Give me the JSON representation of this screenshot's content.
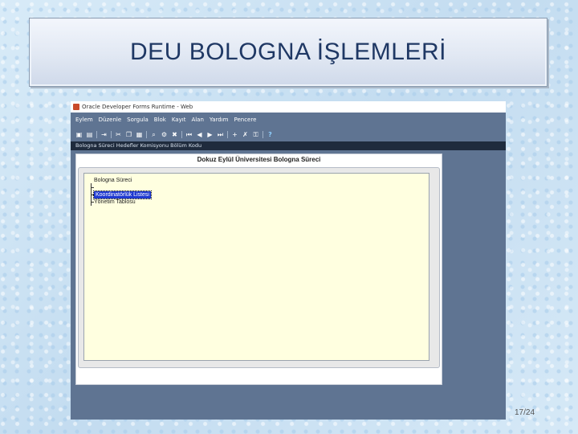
{
  "slide": {
    "title": "DEU BOLOGNA İŞLEMLERİ",
    "page_number": "17/24"
  },
  "window": {
    "title": "Oracle Developer Forms Runtime - Web",
    "menu": [
      "Eylem",
      "Düzenle",
      "Sorgula",
      "Blok",
      "Kayıt",
      "Alan",
      "Yardım",
      "Pencere"
    ],
    "status_line": "Bologna Süreci Hedefler Komisyonu Bölüm Kodu"
  },
  "form": {
    "title": "Dokuz Eylül Üniversitesi Bologna Süreci",
    "tree_items": [
      {
        "label": "Bologna Süreci",
        "selected": false
      },
      {
        "label": "Koordinatörlük Listesi",
        "selected": true
      },
      {
        "label": "Yönetim Tablosu",
        "selected": false
      }
    ]
  },
  "colors": {
    "title_text": "#1f3864",
    "window_bg": "#5f7492",
    "tree_bg": "#ffffe0",
    "selection": "#1f39d0"
  }
}
